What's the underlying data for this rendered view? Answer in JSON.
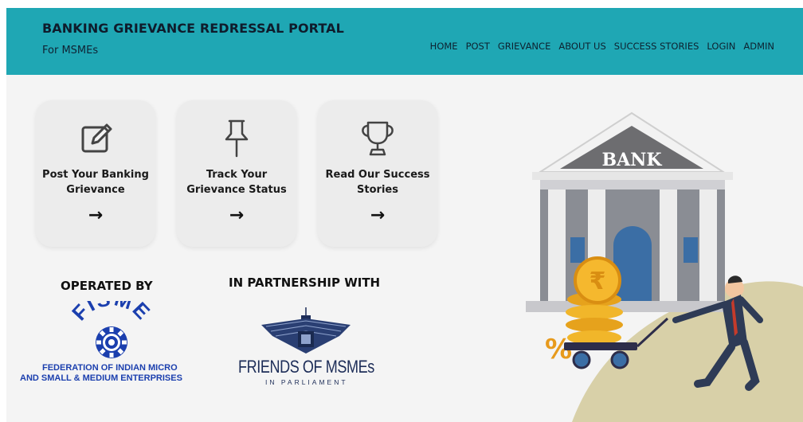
{
  "header": {
    "title": "BANKING GRIEVANCE REDRESSAL PORTAL",
    "subtitle": "For MSMEs",
    "nav": [
      "HOME",
      "POST",
      "GRIEVANCE",
      "ABOUT US",
      "SUCCESS STORIES",
      "LOGIN",
      "ADMIN"
    ]
  },
  "cards": [
    {
      "label": "Post Your Banking Grievance",
      "icon": "edit-icon",
      "arrow": "→"
    },
    {
      "label": "Track Your Grievance Status",
      "icon": "pushpin-icon",
      "arrow": "→"
    },
    {
      "label": "Read Our Success Stories",
      "icon": "trophy-icon",
      "arrow": "→"
    }
  ],
  "operated_by": {
    "title": "OPERATED BY",
    "logo_text": "FISME",
    "line1": "FEDERATION OF INDIAN MICRO",
    "line2": "AND SMALL & MEDIUM ENTERPRISES"
  },
  "partnership": {
    "title": "IN PARTNERSHIP WITH",
    "name": "FRIENDS OF MSMEs",
    "sub": "IN PARLIAMENT"
  },
  "hero": {
    "bank_sign": "BANK",
    "rupee": "₹",
    "percent": "%"
  },
  "colors": {
    "header_bg": "#1fa7b4",
    "page_bg": "#f4f4f4",
    "card_bg": "#ececec",
    "fisme_blue": "#1b3fae",
    "blob": "#d8d0a8"
  }
}
